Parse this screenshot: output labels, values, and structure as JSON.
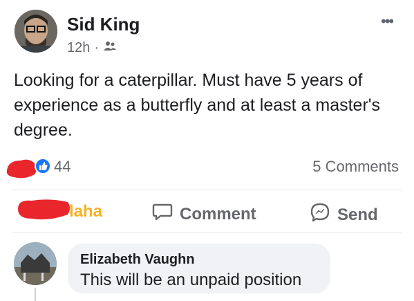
{
  "post": {
    "author": "Sid King",
    "time": "12h",
    "separator": "·",
    "text": "Looking for a caterpillar. Must have 5 years of experience as a butterfly and at least a master's degree.",
    "more_label": "•••"
  },
  "reactions": {
    "count": "44",
    "comments": "5 Comments"
  },
  "actions": {
    "haha_label": "laha",
    "comment_label": "Comment",
    "send_label": "Send"
  },
  "comment": {
    "author": "Elizabeth Vaughn",
    "text": "This will be an unpaid position"
  },
  "colors": {
    "primary_text": "#1c1e21",
    "secondary_text": "#65676b",
    "haha_orange": "#f7b125",
    "redaction_red": "#e8262c",
    "like_blue": "#1877f2"
  },
  "icons": [
    "avatar-photo",
    "friends-audience-icon",
    "more-options-icon",
    "like-reaction-icon",
    "comment-icon",
    "messenger-send-icon"
  ]
}
